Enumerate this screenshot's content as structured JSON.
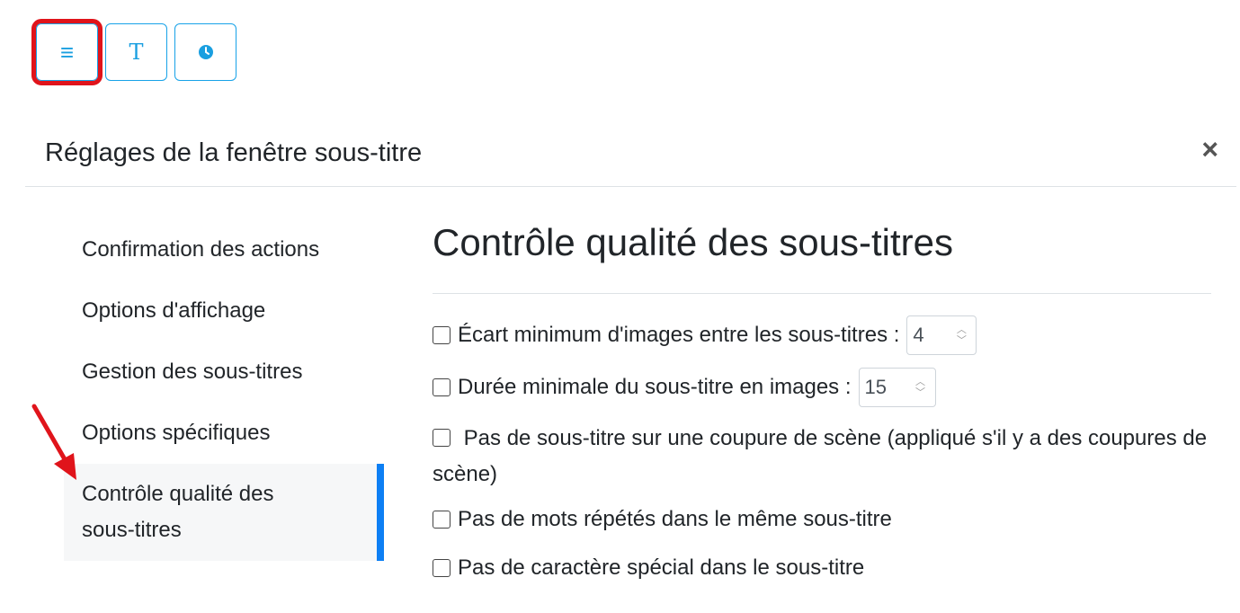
{
  "toolbar": {
    "buttons": [
      {
        "icon": "menu-icon",
        "glyph": "≡"
      },
      {
        "icon": "text-icon",
        "glyph": "T"
      },
      {
        "icon": "clock-icon",
        "glyph": ""
      }
    ],
    "accent_color": "#1a9fe0",
    "highlight_color": "#e0141b"
  },
  "modal": {
    "title": "Réglages de la fenêtre sous-titre",
    "close_glyph": "×"
  },
  "sidebar": {
    "items": [
      {
        "label": "Confirmation des actions"
      },
      {
        "label": "Options d'affichage"
      },
      {
        "label": "Gestion des sous-titres"
      },
      {
        "label": "Options spécifiques"
      },
      {
        "label": "Contrôle qualité des sous-titres",
        "active": true
      }
    ],
    "active_color": "#0d7ff4"
  },
  "main": {
    "heading": "Contrôle qualité des sous-titres",
    "options": [
      {
        "label": "Écart minimum d'images entre les sous-titres :",
        "value": "4",
        "checked": false
      },
      {
        "label": "Durée minimale du sous-titre en images :",
        "value": "15",
        "checked": false
      },
      {
        "label": "Pas de sous-titre sur une coupure de scène (appliqué s'il y a des coupures de scène)",
        "checked": false
      },
      {
        "label": "Pas de mots répétés dans le même sous-titre",
        "checked": false
      },
      {
        "label": "Pas de caractère spécial dans le sous-titre",
        "checked": false
      }
    ]
  }
}
